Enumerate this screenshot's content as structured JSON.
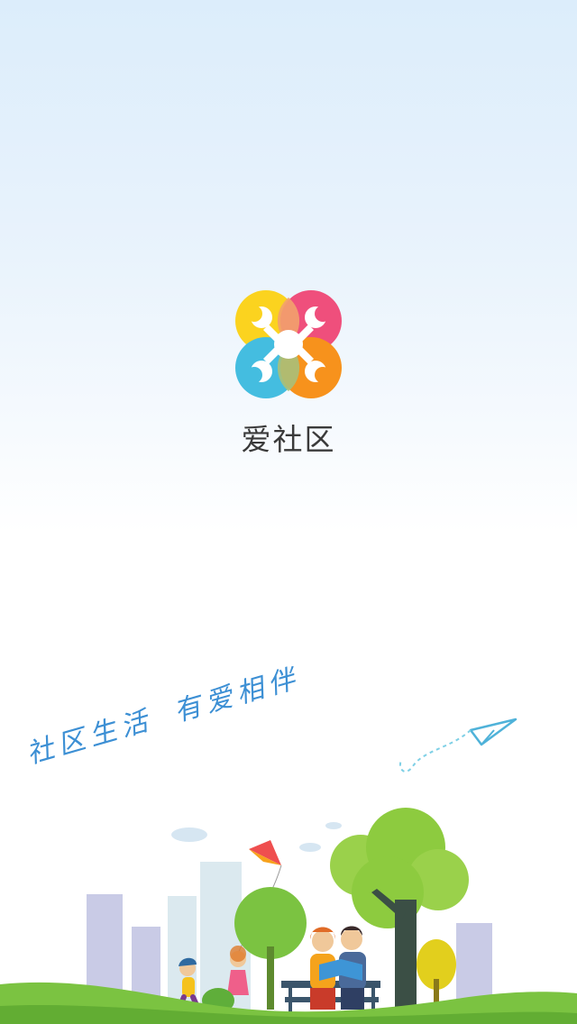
{
  "app": {
    "name": "爱社区",
    "slogan_part1": "社区生活",
    "slogan_part2": "有爱相伴"
  },
  "icons": {
    "logo": "four-people-circle-logo",
    "illustration": "community-park-family-illustration",
    "plane": "paper-plane-icon",
    "kite": "kite-icon"
  },
  "colors": {
    "yellow": "#fbd31f",
    "pink": "#ef4f7c",
    "cyan": "#44bde0",
    "orange": "#f7921c",
    "text": "#3a3a3a",
    "slogan": "#3c8fd4",
    "grass": "#7bc341",
    "tree": "#8dcb3f"
  }
}
